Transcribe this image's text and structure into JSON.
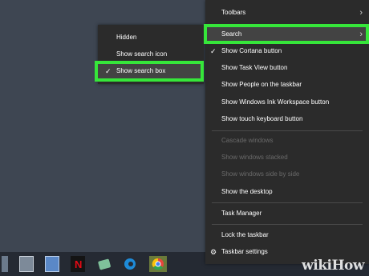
{
  "colors": {
    "highlight": "#36e63a",
    "desktop": "#3e4652",
    "menu_bg": "#2b2b2b"
  },
  "context_menu": {
    "items": [
      {
        "label": "Toolbars",
        "has_submenu": true
      },
      {
        "label": "Search",
        "has_submenu": true,
        "highlighted": true
      },
      {
        "label": "Show Cortana button",
        "checked": true
      },
      {
        "label": "Show Task View button"
      },
      {
        "label": "Show People on the taskbar"
      },
      {
        "label": "Show Windows Ink Workspace button"
      },
      {
        "label": "Show touch keyboard button"
      },
      {
        "label": "Cascade windows",
        "disabled": true
      },
      {
        "label": "Show windows stacked",
        "disabled": true
      },
      {
        "label": "Show windows side by side",
        "disabled": true
      },
      {
        "label": "Show the desktop"
      },
      {
        "label": "Task Manager"
      },
      {
        "label": "Lock the taskbar"
      },
      {
        "label": "Taskbar settings",
        "icon": "gear-icon"
      }
    ]
  },
  "search_submenu": {
    "items": [
      {
        "label": "Hidden"
      },
      {
        "label": "Show search icon"
      },
      {
        "label": "Show search box",
        "checked": true,
        "highlighted": true
      }
    ]
  },
  "taskbar": {
    "icons": [
      "app-icon",
      "calculator-icon",
      "notepad-icon",
      "netflix-icon",
      "app-icon",
      "edge-icon",
      "chrome-icon"
    ]
  },
  "watermark": {
    "part1": "wiki",
    "part2": "How"
  }
}
